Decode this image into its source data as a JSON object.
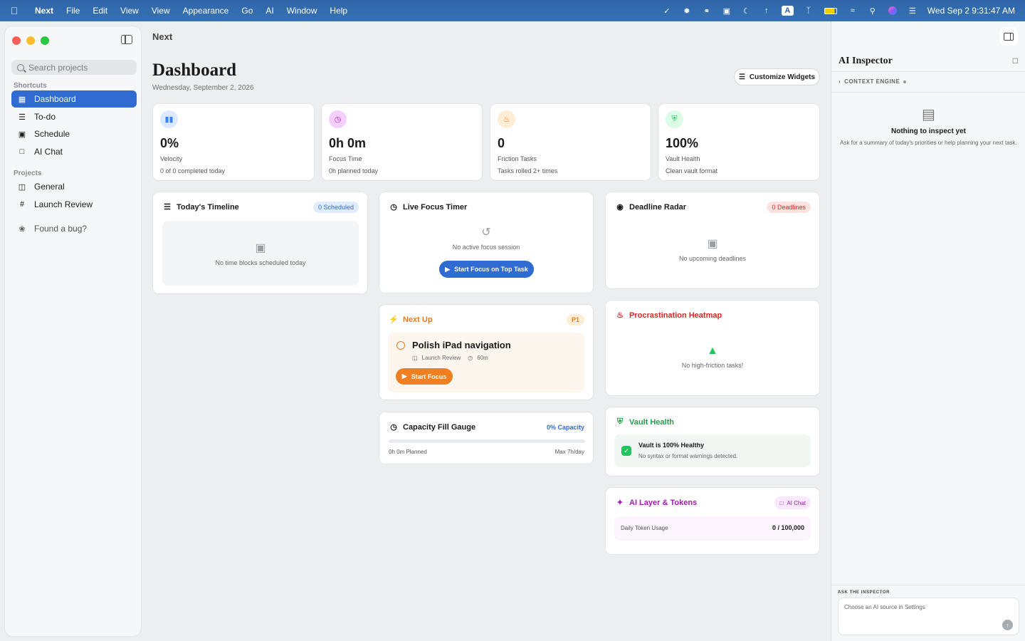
{
  "menubar": {
    "items": [
      "Next",
      "File",
      "Edit",
      "View",
      "View",
      "Appearance",
      "Go",
      "AI",
      "Window",
      "Help"
    ],
    "clock": "Wed Sep 2  9:31:47 AM"
  },
  "sidebar": {
    "search_placeholder": "Search projects",
    "shortcuts_label": "Shortcuts",
    "shortcuts": [
      {
        "label": "Dashboard",
        "icon": "grid-icon"
      },
      {
        "label": "To-do",
        "icon": "checklist-icon"
      },
      {
        "label": "Schedule",
        "icon": "calendar-icon"
      },
      {
        "label": "AI Chat",
        "icon": "chat-icon"
      }
    ],
    "projects_label": "Projects",
    "projects": [
      {
        "label": "General",
        "icon": "inbox-icon"
      },
      {
        "label": "Launch Review",
        "icon": "hash-icon"
      }
    ],
    "bug_label": "Found a bug?"
  },
  "main": {
    "window_title": "Next",
    "title": "Dashboard",
    "date": "Wednesday, September 2, 2026",
    "customize_label": "Customize Widgets"
  },
  "stats": [
    {
      "value": "0%",
      "label": "Velocity",
      "sub": "0 of 0 completed today",
      "icon": "bar-chart-icon",
      "color": "#3b82f6"
    },
    {
      "value": "0h 0m",
      "label": "Focus Time",
      "sub": "0h planned today",
      "icon": "clock-icon",
      "color": "#c026d3"
    },
    {
      "value": "0",
      "label": "Friction Tasks",
      "sub": "Tasks rolled 2+ times",
      "icon": "flame-icon",
      "color": "#f97316"
    },
    {
      "value": "100%",
      "label": "Vault Health",
      "sub": "Clean vault format",
      "icon": "shield-icon",
      "color": "#22c55e"
    }
  ],
  "timeline": {
    "title": "Today's Timeline",
    "badge": "0 Scheduled",
    "empty": "No time blocks scheduled today"
  },
  "focus_timer": {
    "title": "Live Focus Timer",
    "empty": "No active focus session",
    "button": "Start Focus on Top Task"
  },
  "deadline": {
    "title": "Deadline Radar",
    "badge": "0 Deadlines",
    "empty": "No upcoming deadlines"
  },
  "next_up": {
    "title": "Next Up",
    "badge": "P1",
    "task": "Polish iPad navigation",
    "project": "Launch Review",
    "duration": "60m",
    "button": "Start Focus"
  },
  "heatmap": {
    "title": "Procrastination Heatmap",
    "empty": "No high-friction tasks!"
  },
  "capacity": {
    "title": "Capacity Fill Gauge",
    "badge": "0% Capacity",
    "planned": "0h 0m Planned",
    "max": "Max 7h/day",
    "fill": 0
  },
  "vault": {
    "title": "Vault Health",
    "heading": "Vault is 100% Healthy",
    "sub": "No syntax or format warnings detected."
  },
  "ai_layer": {
    "title": "AI Layer & Tokens",
    "badge": "AI Chat",
    "usage_label": "Daily Token Usage",
    "usage_value": "0 / 100,000"
  },
  "inspector": {
    "title": "AI Inspector",
    "context_label": "CONTEXT ENGINE",
    "empty_title": "Nothing to inspect yet",
    "empty_sub": "Ask for a summary of today's priorities or help planning your next task.",
    "ask_label": "ASK THE INSPECTOR",
    "ask_placeholder": "Choose an AI source in Settings"
  }
}
